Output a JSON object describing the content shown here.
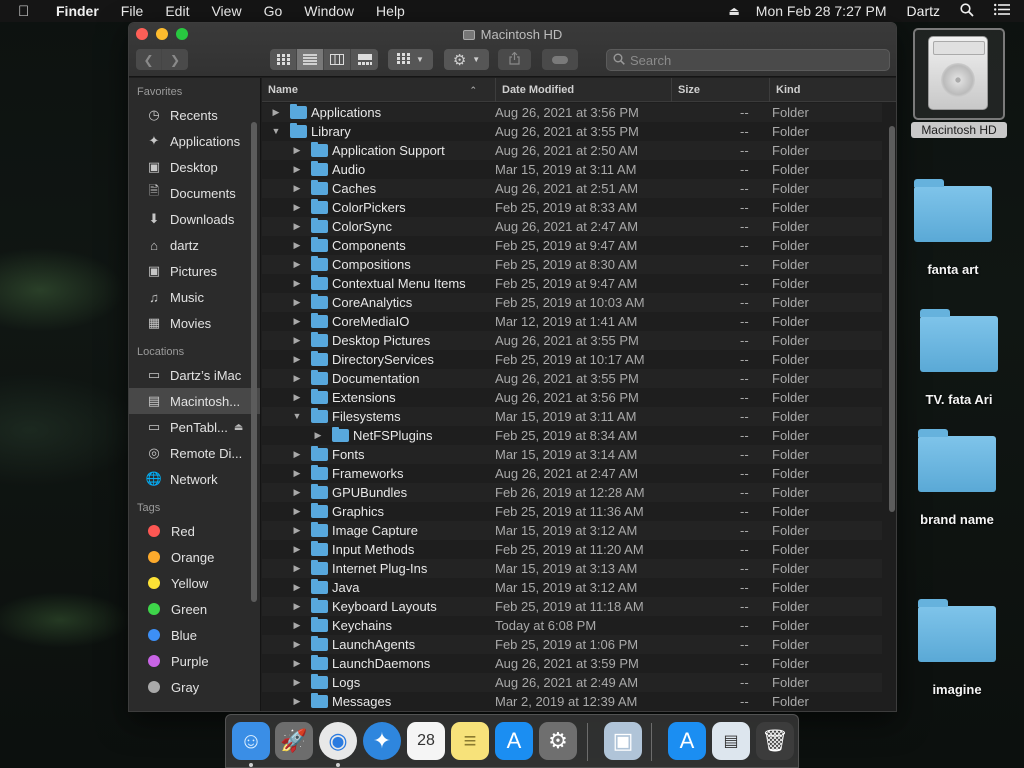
{
  "menubar": {
    "app_name": "Finder",
    "items": [
      "File",
      "Edit",
      "View",
      "Go",
      "Window",
      "Help"
    ],
    "datetime": "Mon Feb 28  7:27 PM",
    "user": "Dartz"
  },
  "window": {
    "title": "Macintosh HD",
    "search_placeholder": "Search"
  },
  "sidebar": {
    "favorites_header": "Favorites",
    "favorites": [
      {
        "label": "Recents",
        "icon": "clock-icon"
      },
      {
        "label": "Applications",
        "icon": "applications-icon"
      },
      {
        "label": "Desktop",
        "icon": "desktop-icon"
      },
      {
        "label": "Documents",
        "icon": "document-icon"
      },
      {
        "label": "Downloads",
        "icon": "download-icon"
      },
      {
        "label": "dartz",
        "icon": "home-icon"
      },
      {
        "label": "Pictures",
        "icon": "camera-icon"
      },
      {
        "label": "Music",
        "icon": "music-icon"
      },
      {
        "label": "Movies",
        "icon": "film-icon"
      }
    ],
    "locations_header": "Locations",
    "locations": [
      {
        "label": "Dartz’s iMac",
        "icon": "imac-icon"
      },
      {
        "label": "Macintosh...",
        "icon": "hard-drive-icon"
      },
      {
        "label": "PenTabl...",
        "icon": "disk-icon"
      },
      {
        "label": "Remote Di...",
        "icon": "remote-disc-icon"
      },
      {
        "label": "Network",
        "icon": "network-icon"
      }
    ],
    "tags_header": "Tags",
    "tags": [
      {
        "label": "Red",
        "color": "#fc5753"
      },
      {
        "label": "Orange",
        "color": "#fdaa2c"
      },
      {
        "label": "Yellow",
        "color": "#fde236"
      },
      {
        "label": "Green",
        "color": "#3ed54a"
      },
      {
        "label": "Blue",
        "color": "#3d8ff5"
      },
      {
        "label": "Purple",
        "color": "#c864e5"
      },
      {
        "label": "Gray",
        "color": "#a9a9a9"
      }
    ]
  },
  "columns": {
    "name": "Name",
    "date_modified": "Date Modified",
    "size": "Size",
    "kind": "Kind"
  },
  "files": [
    {
      "name": "Applications",
      "date": "Aug 26, 2021 at 3:56 PM",
      "size": "--",
      "kind": "Folder",
      "level": 0,
      "expanded": false
    },
    {
      "name": "Library",
      "date": "Aug 26, 2021 at 3:55 PM",
      "size": "--",
      "kind": "Folder",
      "level": 0,
      "expanded": true
    },
    {
      "name": "Application Support",
      "date": "Aug 26, 2021 at 2:50 AM",
      "size": "--",
      "kind": "Folder",
      "level": 1,
      "expanded": false
    },
    {
      "name": "Audio",
      "date": "Mar 15, 2019 at 3:11 AM",
      "size": "--",
      "kind": "Folder",
      "level": 1,
      "expanded": false
    },
    {
      "name": "Caches",
      "date": "Aug 26, 2021 at 2:51 AM",
      "size": "--",
      "kind": "Folder",
      "level": 1,
      "expanded": false
    },
    {
      "name": "ColorPickers",
      "date": "Feb 25, 2019 at 8:33 AM",
      "size": "--",
      "kind": "Folder",
      "level": 1,
      "expanded": false
    },
    {
      "name": "ColorSync",
      "date": "Aug 26, 2021 at 2:47 AM",
      "size": "--",
      "kind": "Folder",
      "level": 1,
      "expanded": false
    },
    {
      "name": "Components",
      "date": "Feb 25, 2019 at 9:47 AM",
      "size": "--",
      "kind": "Folder",
      "level": 1,
      "expanded": false
    },
    {
      "name": "Compositions",
      "date": "Feb 25, 2019 at 8:30 AM",
      "size": "--",
      "kind": "Folder",
      "level": 1,
      "expanded": false
    },
    {
      "name": "Contextual Menu Items",
      "date": "Feb 25, 2019 at 9:47 AM",
      "size": "--",
      "kind": "Folder",
      "level": 1,
      "expanded": false
    },
    {
      "name": "CoreAnalytics",
      "date": "Feb 25, 2019 at 10:03 AM",
      "size": "--",
      "kind": "Folder",
      "level": 1,
      "expanded": false
    },
    {
      "name": "CoreMediaIO",
      "date": "Mar 12, 2019 at 1:41 AM",
      "size": "--",
      "kind": "Folder",
      "level": 1,
      "expanded": false
    },
    {
      "name": "Desktop Pictures",
      "date": "Aug 26, 2021 at 3:55 PM",
      "size": "--",
      "kind": "Folder",
      "level": 1,
      "expanded": false
    },
    {
      "name": "DirectoryServices",
      "date": "Feb 25, 2019 at 10:17 AM",
      "size": "--",
      "kind": "Folder",
      "level": 1,
      "expanded": false
    },
    {
      "name": "Documentation",
      "date": "Aug 26, 2021 at 3:55 PM",
      "size": "--",
      "kind": "Folder",
      "level": 1,
      "expanded": false
    },
    {
      "name": "Extensions",
      "date": "Aug 26, 2021 at 3:56 PM",
      "size": "--",
      "kind": "Folder",
      "level": 1,
      "expanded": false
    },
    {
      "name": "Filesystems",
      "date": "Mar 15, 2019 at 3:11 AM",
      "size": "--",
      "kind": "Folder",
      "level": 1,
      "expanded": true
    },
    {
      "name": "NetFSPlugins",
      "date": "Feb 25, 2019 at 8:34 AM",
      "size": "--",
      "kind": "Folder",
      "level": 2,
      "expanded": false
    },
    {
      "name": "Fonts",
      "date": "Mar 15, 2019 at 3:14 AM",
      "size": "--",
      "kind": "Folder",
      "level": 1,
      "expanded": false
    },
    {
      "name": "Frameworks",
      "date": "Aug 26, 2021 at 2:47 AM",
      "size": "--",
      "kind": "Folder",
      "level": 1,
      "expanded": false
    },
    {
      "name": "GPUBundles",
      "date": "Feb 26, 2019 at 12:28 AM",
      "size": "--",
      "kind": "Folder",
      "level": 1,
      "expanded": false
    },
    {
      "name": "Graphics",
      "date": "Feb 25, 2019 at 11:36 AM",
      "size": "--",
      "kind": "Folder",
      "level": 1,
      "expanded": false
    },
    {
      "name": "Image Capture",
      "date": "Mar 15, 2019 at 3:12 AM",
      "size": "--",
      "kind": "Folder",
      "level": 1,
      "expanded": false
    },
    {
      "name": "Input Methods",
      "date": "Feb 25, 2019 at 11:20 AM",
      "size": "--",
      "kind": "Folder",
      "level": 1,
      "expanded": false
    },
    {
      "name": "Internet Plug-Ins",
      "date": "Mar 15, 2019 at 3:13 AM",
      "size": "--",
      "kind": "Folder",
      "level": 1,
      "expanded": false
    },
    {
      "name": "Java",
      "date": "Mar 15, 2019 at 3:12 AM",
      "size": "--",
      "kind": "Folder",
      "level": 1,
      "expanded": false
    },
    {
      "name": "Keyboard Layouts",
      "date": "Feb 25, 2019 at 11:18 AM",
      "size": "--",
      "kind": "Folder",
      "level": 1,
      "expanded": false
    },
    {
      "name": "Keychains",
      "date": "Today at 6:08 PM",
      "size": "--",
      "kind": "Folder",
      "level": 1,
      "expanded": false
    },
    {
      "name": "LaunchAgents",
      "date": "Feb 25, 2019 at 1:06 PM",
      "size": "--",
      "kind": "Folder",
      "level": 1,
      "expanded": false
    },
    {
      "name": "LaunchDaemons",
      "date": "Aug 26, 2021 at 3:59 PM",
      "size": "--",
      "kind": "Folder",
      "level": 1,
      "expanded": false
    },
    {
      "name": "Logs",
      "date": "Aug 26, 2021 at 2:49 AM",
      "size": "--",
      "kind": "Folder",
      "level": 1,
      "expanded": false
    },
    {
      "name": "Messages",
      "date": "Mar 2, 2019 at 12:39 AM",
      "size": "--",
      "kind": "Folder",
      "level": 1,
      "expanded": false
    }
  ],
  "desktop": {
    "drive_label": "Macintosh HD",
    "folders": [
      "fanta art",
      "TV. fata Ari",
      "brand name",
      "imagine"
    ]
  },
  "dock": {
    "apps": [
      {
        "name": "finder-icon",
        "color": "#3a8ee6",
        "glyph": "☺",
        "running": true
      },
      {
        "name": "launchpad-icon",
        "color": "#6d6d6d",
        "glyph": "🚀",
        "running": false
      },
      {
        "name": "chrome-icon",
        "color": "#e8e8e8",
        "glyph": "◉",
        "running": true
      },
      {
        "name": "safari-icon",
        "color": "#2e86de",
        "glyph": "✦",
        "running": false
      },
      {
        "name": "calendar-icon",
        "color": "#f5f5f5",
        "glyph": "28",
        "running": false
      },
      {
        "name": "notes-icon",
        "color": "#f7e27a",
        "glyph": "≡",
        "running": false
      },
      {
        "name": "app-store-icon",
        "color": "#1b8ef2",
        "glyph": "A",
        "running": false
      },
      {
        "name": "system-preferences-icon",
        "color": "#6f6f6f",
        "glyph": "⚙",
        "running": false
      },
      {
        "name": "preview-icon",
        "color": "#b0c4d8",
        "glyph": "▣",
        "running": false
      },
      {
        "name": "applications-folder-icon",
        "color": "#1b8ef2",
        "glyph": "A",
        "running": false
      },
      {
        "name": "downloads-stack-icon",
        "color": "#dde6ee",
        "glyph": "▤",
        "running": false
      },
      {
        "name": "trash-icon",
        "color": "#3c3c3c",
        "glyph": "🗑",
        "running": false
      }
    ]
  }
}
